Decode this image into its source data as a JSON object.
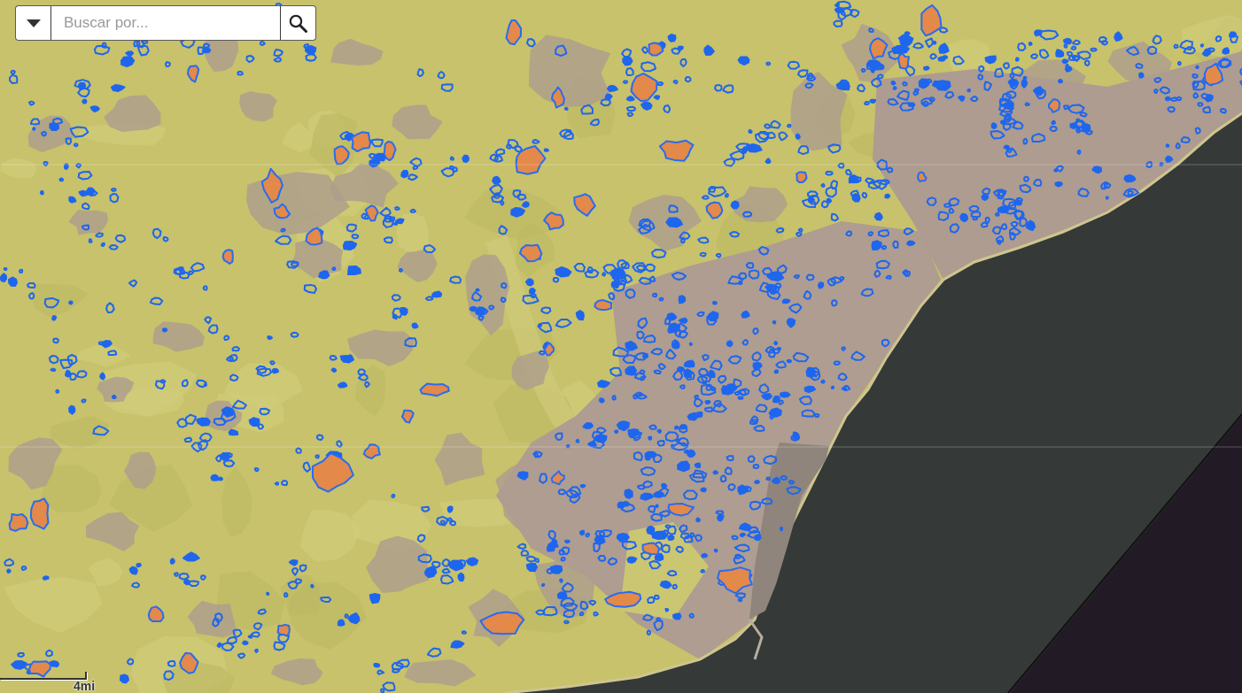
{
  "search": {
    "placeholder": "Buscar por..."
  },
  "scale_bar": {
    "label": "4mi"
  }
}
